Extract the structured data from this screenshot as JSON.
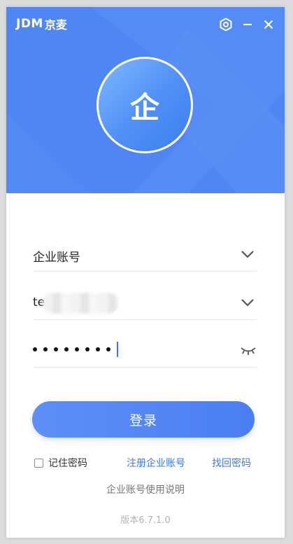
{
  "header": {
    "brand_mark": "JDM",
    "brand_name": "京麦",
    "settings_icon": "settings-hexagon-icon",
    "minimize_icon": "minimize-icon",
    "close_icon": "close-icon",
    "background_color": "#4f86f3",
    "avatar_text": "企"
  },
  "form": {
    "account_type": {
      "value": "企业账号",
      "icon": "chevron-down-icon"
    },
    "username": {
      "value_visible_prefix": "te",
      "icon": "chevron-down-icon"
    },
    "password": {
      "masked_length": 8,
      "icon": "eye-closed-icon"
    }
  },
  "login_button": {
    "label": "登录",
    "color": "#5589f4"
  },
  "options": {
    "remember_label": "记住密码",
    "remember_checked": false,
    "register_link": "注册企业账号",
    "forgot_link": "找回密码"
  },
  "footer": {
    "help_text": "企业账号使用说明",
    "version_text": "版本6.7.1.0"
  },
  "accent_color": "#3b78f0"
}
